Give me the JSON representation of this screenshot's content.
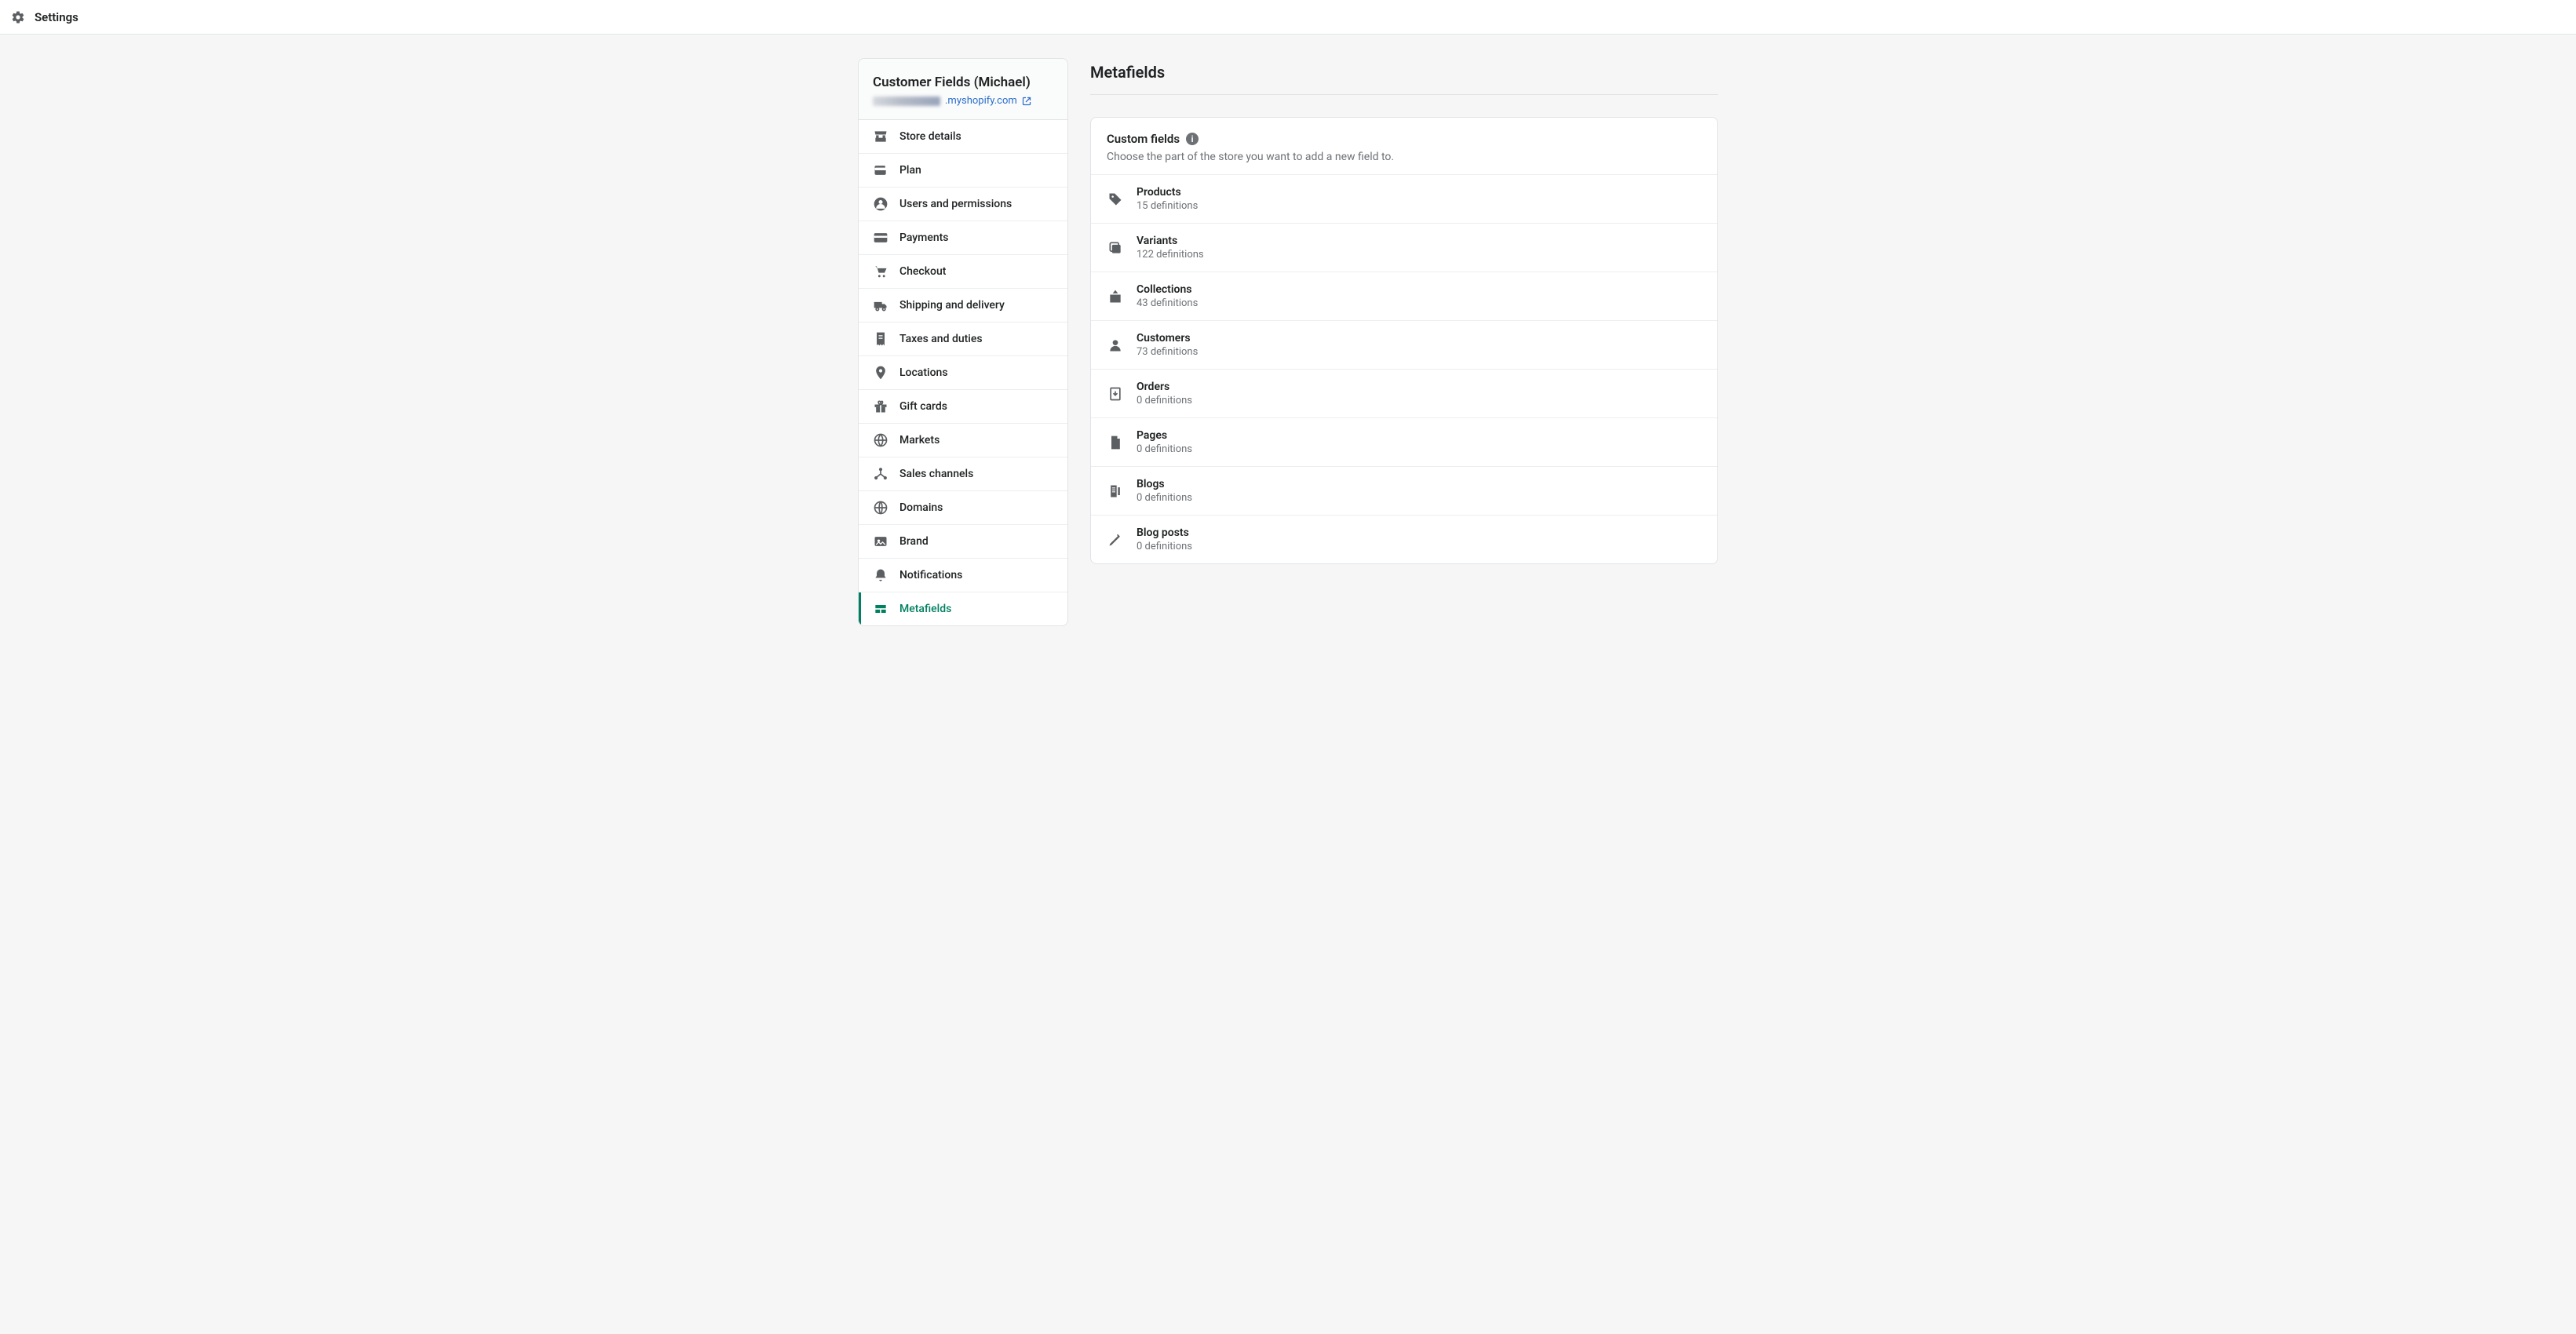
{
  "topbar": {
    "title": "Settings"
  },
  "sidebar": {
    "store_name": "Customer Fields (Michael)",
    "domain_suffix": ".myshopify.com",
    "items": [
      {
        "icon": "store",
        "label": "Store details"
      },
      {
        "icon": "wallet",
        "label": "Plan"
      },
      {
        "icon": "user-circle",
        "label": "Users and permissions"
      },
      {
        "icon": "card",
        "label": "Payments"
      },
      {
        "icon": "cart",
        "label": "Checkout"
      },
      {
        "icon": "truck",
        "label": "Shipping and delivery"
      },
      {
        "icon": "receipt",
        "label": "Taxes and duties"
      },
      {
        "icon": "pin",
        "label": "Locations"
      },
      {
        "icon": "gift",
        "label": "Gift cards"
      },
      {
        "icon": "globe",
        "label": "Markets"
      },
      {
        "icon": "channels",
        "label": "Sales channels"
      },
      {
        "icon": "globe2",
        "label": "Domains"
      },
      {
        "icon": "brand",
        "label": "Brand"
      },
      {
        "icon": "bell",
        "label": "Notifications"
      },
      {
        "icon": "metafields",
        "label": "Metafields",
        "active": true
      }
    ]
  },
  "main": {
    "title": "Metafields",
    "card_title": "Custom fields",
    "card_help": "Choose the part of the store you want to add a new field to.",
    "rows": [
      {
        "icon": "tag",
        "title": "Products",
        "sub": "15 definitions"
      },
      {
        "icon": "variant",
        "title": "Variants",
        "sub": "122 definitions"
      },
      {
        "icon": "collection",
        "title": "Collections",
        "sub": "43 definitions"
      },
      {
        "icon": "person",
        "title": "Customers",
        "sub": "73 definitions"
      },
      {
        "icon": "order",
        "title": "Orders",
        "sub": "0 definitions"
      },
      {
        "icon": "page",
        "title": "Pages",
        "sub": "0 definitions"
      },
      {
        "icon": "blog",
        "title": "Blogs",
        "sub": "0 definitions"
      },
      {
        "icon": "pencil",
        "title": "Blog posts",
        "sub": "0 definitions"
      }
    ]
  }
}
